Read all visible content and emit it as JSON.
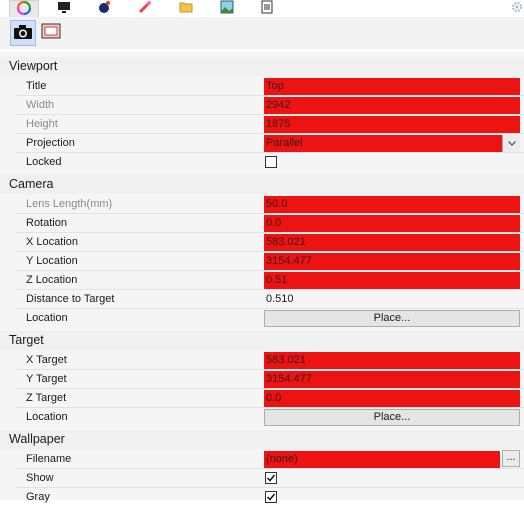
{
  "tabs": [
    {
      "icon": "color-wheel-icon",
      "active": true
    },
    {
      "icon": "monitor-icon",
      "active": false
    },
    {
      "icon": "render-sphere-icon",
      "active": false
    },
    {
      "icon": "paint-tube-icon",
      "active": false
    },
    {
      "icon": "folder-icon",
      "active": false
    },
    {
      "icon": "image-icon",
      "active": false
    },
    {
      "icon": "document-icon",
      "active": false
    }
  ],
  "subtoolbar": [
    {
      "icon": "camera-icon",
      "selected": true
    },
    {
      "icon": "frame-icon",
      "selected": false
    }
  ],
  "viewport": {
    "header": "Viewport",
    "title_label": "Title",
    "title_value": "Top",
    "width_label": "Width",
    "width_value": "2942",
    "height_label": "Height",
    "height_value": "1875",
    "projection_label": "Projection",
    "projection_value": "Parallel",
    "locked_label": "Locked",
    "locked_checked": false
  },
  "camera": {
    "header": "Camera",
    "lens_label": "Lens Length(mm)",
    "lens_value": "50.0",
    "rotation_label": "Rotation",
    "rotation_value": "0.0",
    "x_label": "X Location",
    "x_value": "583.021",
    "y_label": "Y Location",
    "y_value": "3154.477",
    "z_label": "Z Location",
    "z_value": "0.51",
    "distance_label": "Distance to Target",
    "distance_value": "0.510",
    "location_label": "Location",
    "place_button": "Place..."
  },
  "target": {
    "header": "Target",
    "x_label": "X Target",
    "x_value": "583.021",
    "y_label": "Y Target",
    "y_value": "3154.477",
    "z_label": "Z Target",
    "z_value": "0.0",
    "location_label": "Location",
    "place_button": "Place..."
  },
  "wallpaper": {
    "header": "Wallpaper",
    "filename_label": "Filename",
    "filename_value": "(none)",
    "browse_button": "...",
    "show_label": "Show",
    "show_checked": true,
    "gray_label": "Gray",
    "gray_checked": true
  },
  "colors": {
    "highlight": "#ee1313",
    "accent": "#cfe0f7"
  }
}
